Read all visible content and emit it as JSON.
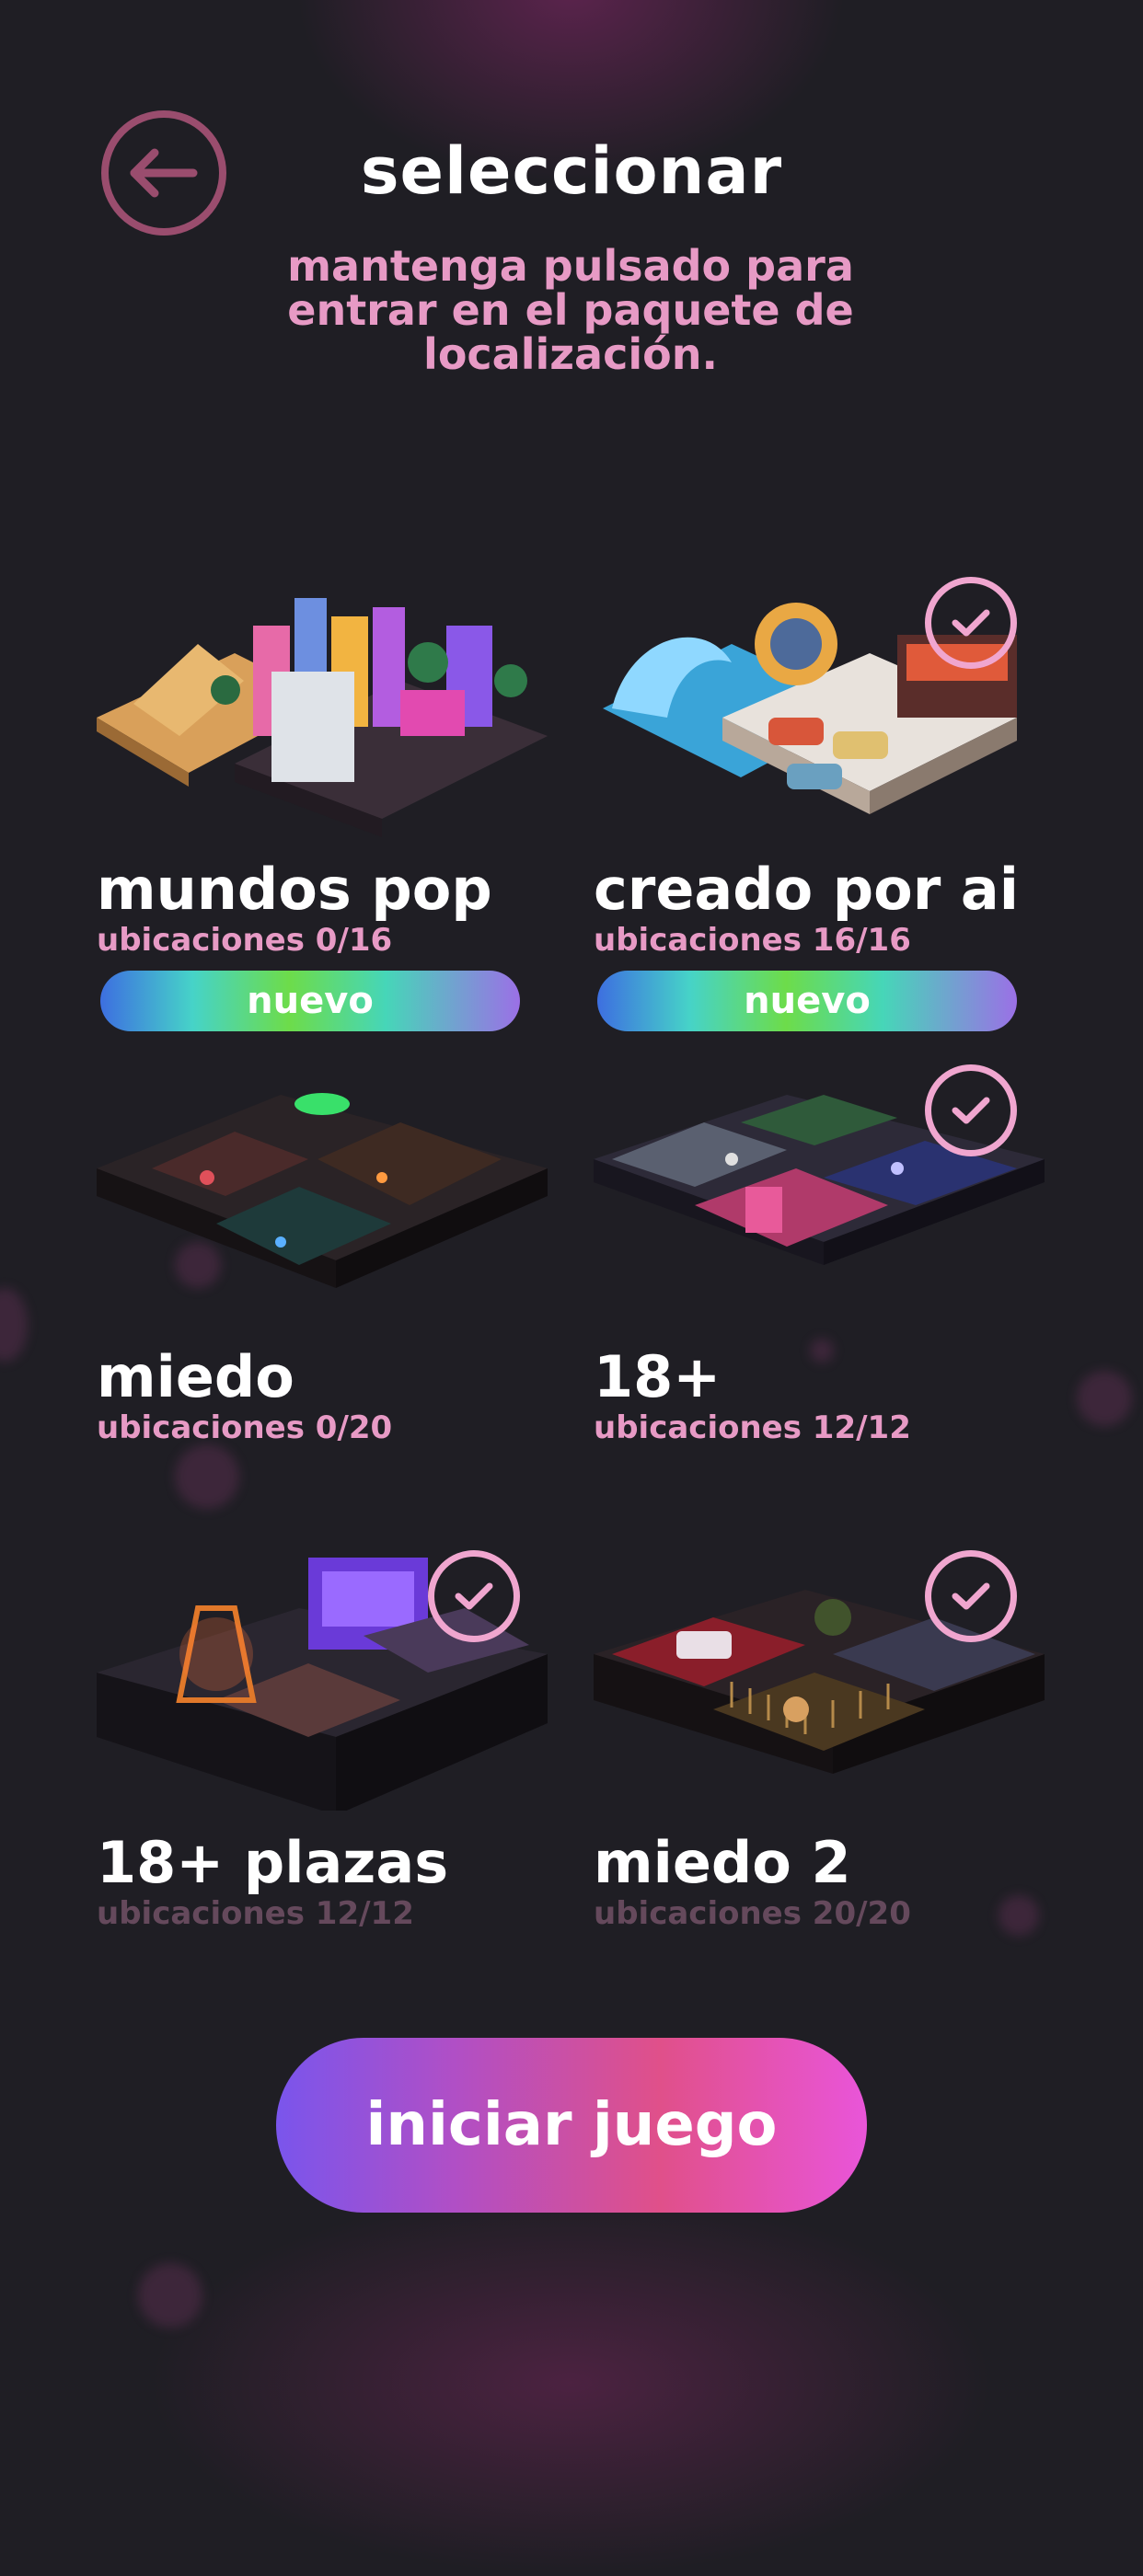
{
  "header": {
    "title": "seleccionar",
    "subtitle": "mantenga pulsado para entrar en el paquete de localización."
  },
  "packs": [
    {
      "name": "mundos pop",
      "count": "ubicaciones 0/16",
      "badge": "nuevo",
      "selected": false
    },
    {
      "name": "creado por ai",
      "count": "ubicaciones 16/16",
      "badge": "nuevo",
      "selected": true
    },
    {
      "name": "miedo",
      "count": "ubicaciones 0/20",
      "selected": false
    },
    {
      "name": "18+",
      "count": "ubicaciones 12/12",
      "selected": true
    },
    {
      "name": "18+ plazas",
      "count": "ubicaciones 12/12",
      "selected": true
    },
    {
      "name": "miedo 2",
      "count": "ubicaciones 20/20",
      "selected": true
    }
  ],
  "start_button": {
    "label": "iniciar juego"
  },
  "colors": {
    "background": "#1f1e24",
    "accent_pink": "#e79ac5",
    "check_ring": "#f0a6cf",
    "back_ring": "#9a4d6e"
  },
  "icons": {
    "back": "arrow-left-icon",
    "check": "check-icon"
  }
}
